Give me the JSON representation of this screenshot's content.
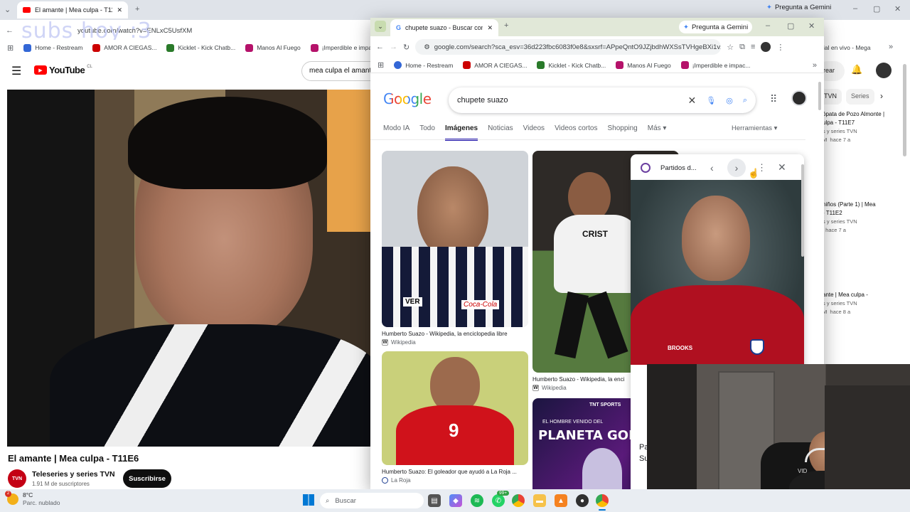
{
  "bg_window": {
    "tab_title": "El amante | Mea culpa - T11E6",
    "url": "youtube.com/watch?v=ENLxC5UsfXM",
    "overlay_text": "subs hoy :3",
    "gemini_label": "Pregunta a Gemini",
    "bookmarks": [
      "Home - Restream",
      "AMOR A CIEGAS...",
      "Kicklet - Kick Chatb...",
      "Manos Al Fuego",
      "¡Imperdible e impac..."
    ],
    "bookmark_right": "ial en vivo - Mega",
    "youtube": {
      "logo": "YouTube",
      "region": "CL",
      "search_value": "mea culpa el amant",
      "create_label": "rear",
      "chips": [
        "TVN",
        "Series"
      ],
      "video_title": "El amante | Mea culpa - T11E6",
      "channel_name": "Teleseries y series TVN",
      "channel_avatar_text": "TVN",
      "subscribers": "1.91 M de suscriptores",
      "subscribe_label": "Suscribirse",
      "recommended": [
        {
          "title_1": "ópata de Pozo Almonte |",
          "title_2": "ulpa - T11E7",
          "channel": "s y series TVN",
          "meta_a": "M",
          "meta_b": "hace 7 a"
        },
        {
          "title_1": "niños (Parte 1) | Mea",
          "title_2": "- T11E2",
          "channel": "s y series TVN",
          "meta_a": "",
          "meta_b": "hace 7 a"
        },
        {
          "title_1": "ante | Mea culpa -",
          "title_2": "",
          "channel": "s y series TVN",
          "meta_a": "M",
          "meta_b": "hace 8 a"
        }
      ]
    }
  },
  "fg_window": {
    "tab_title": "chupete suazo - Buscar con Go",
    "gemini_label": "Pregunta a Gemini",
    "url": "google.com/search?sca_esv=36d223fbc6083f0e8&sxsrf=APpeQntO9JZjbdhWXSsTVHgeBXi1v...",
    "bookmarks": [
      "Home - Restream",
      "AMOR A CIEGAS...",
      "Kicklet - Kick Chatb...",
      "Manos Al Fuego",
      "¡Imperdible e impac..."
    ],
    "google": {
      "logo": "Google",
      "query": "chupete suazo",
      "tabs": [
        "Modo IA",
        "Todo",
        "Imágenes",
        "Noticias",
        "Videos",
        "Videos cortos",
        "Shopping",
        "Más"
      ],
      "active_tab": "Imágenes",
      "tools_label": "Herramientas",
      "results": [
        {
          "caption": "Humberto Suazo - Wikipedia, la enciclopedia libre",
          "source": "Wikipedia"
        },
        {
          "caption": "Humberto Suazo - Wikipedia, la enci",
          "source": "Wikipedia"
        },
        {
          "caption": "Humberto Suazo: El goleador que ayudó a La Roja ...",
          "source": "La Roja"
        },
        {
          "caption": "",
          "source": ""
        }
      ],
      "promo_line_1": "EL HOMBRE VENIDO DEL",
      "promo_line_2": "PLANETA GOL",
      "promo_brand": "TNT SPORTS",
      "jersey_number": "9",
      "shirt_sponsor": "Coca-Cola",
      "shirt_text_a": "VER",
      "shirt_text_b": "CRIST",
      "preview": {
        "source_name": "Partidos d...",
        "brand": "BROOKS",
        "caption_a": "Pa",
        "caption_b": "Su"
      }
    }
  },
  "taskbar": {
    "weather_temp": "8°C",
    "weather_desc": "Parc. nublado",
    "search_placeholder": "Buscar",
    "badge_count": "99+"
  },
  "webcam": {
    "hoodie_text": "VID"
  }
}
